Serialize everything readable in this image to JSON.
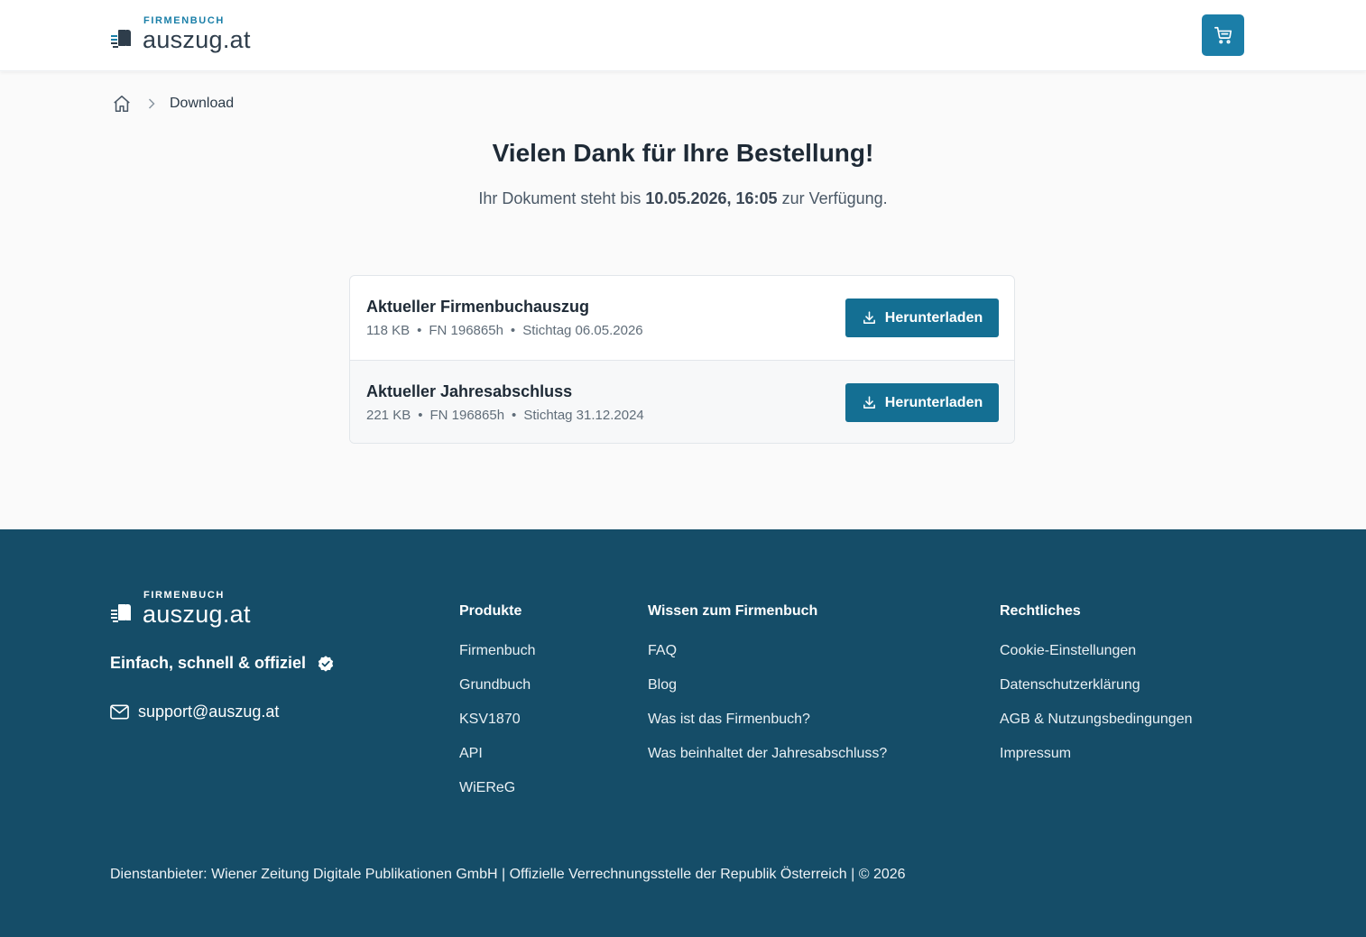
{
  "header": {
    "logo_small": "FIRMENBUCH",
    "logo_big": "auszug.at",
    "cart_icon": "shopping-cart-icon",
    "accent_color": "#1b7ea8"
  },
  "breadcrumb": {
    "home_icon": "home-icon",
    "current": "Download"
  },
  "main": {
    "title": "Vielen Dank für Ihre Bestellung!",
    "subtitle_prefix": "Ihr Dokument steht bis ",
    "subtitle_date": "10.05.2026, 16:05",
    "subtitle_suffix": " zur Verfügung."
  },
  "documents": [
    {
      "name": "Aktueller Firmenbuchauszug",
      "size": "118 KB",
      "fn": "FN 196865h",
      "stichtag": "Stichtag 06.05.2026",
      "button": "Herunterladen"
    },
    {
      "name": "Aktueller Jahresabschluss",
      "size": "221 KB",
      "fn": "FN 196865h",
      "stichtag": "Stichtag 31.12.2024",
      "button": "Herunterladen"
    }
  ],
  "footer": {
    "logo_small": "FIRMENBUCH",
    "logo_big": "auszug.at",
    "tagline": "Einfach, schnell & offiziel",
    "email": "support@auszug.at",
    "background_color": "#154d68",
    "columns": [
      {
        "heading": "Produkte",
        "links": [
          "Firmenbuch",
          "Grundbuch",
          "KSV1870",
          "API",
          "WiEReG"
        ]
      },
      {
        "heading": "Wissen zum Firmenbuch",
        "links": [
          "FAQ",
          "Blog",
          "Was ist das Firmenbuch?",
          "Was beinhaltet der Jahresabschluss?"
        ]
      },
      {
        "heading": "Rechtliches",
        "links": [
          "Cookie-Einstellungen",
          "Datenschutzerklärung",
          "AGB & Nutzungsbedingungen",
          "Impressum"
        ]
      }
    ],
    "legal": "Dienstanbieter: Wiener Zeitung Digitale Publikationen GmbH | Offizielle Verrechnungsstelle der Republik Österreich | © 2026"
  }
}
